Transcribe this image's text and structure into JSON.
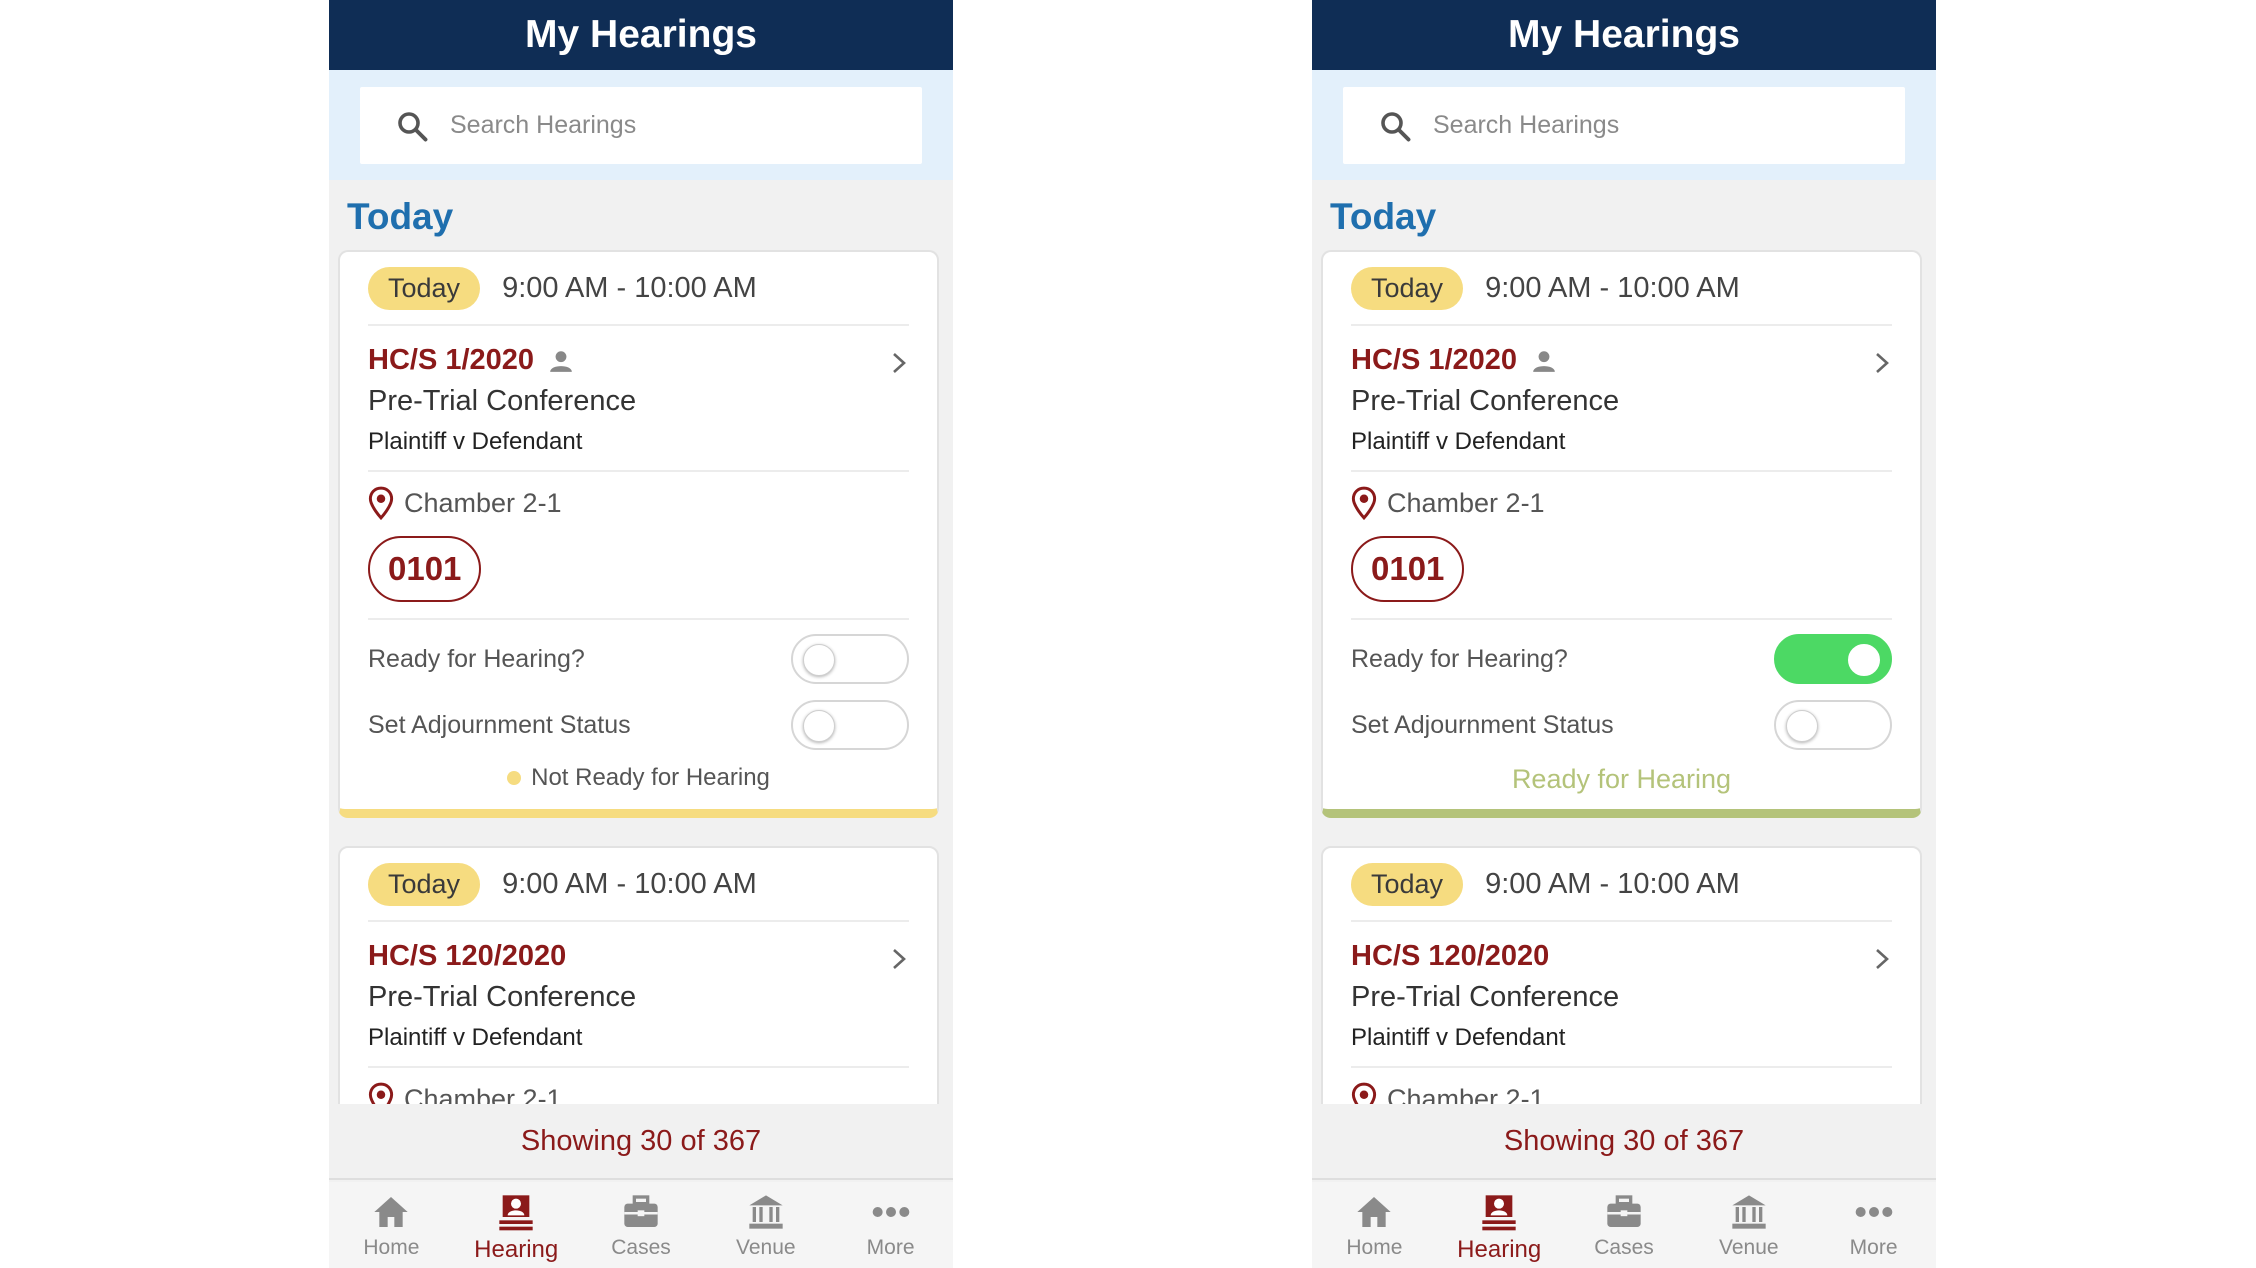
{
  "screens": [
    {
      "header_title": "My Hearings",
      "search_placeholder": "Search Hearings",
      "section_title": "Today",
      "cards": [
        {
          "badge": "Today",
          "time": "9:00 AM - 10:00 AM",
          "case_no": "HC/S 1/2020",
          "case_type": "Pre-Trial Conference",
          "parties": "Plaintiff v Defendant",
          "location": "Chamber 2-1",
          "room": "0101",
          "ready_label": "Ready for Hearing?",
          "ready_on": false,
          "adjourn_label": "Set Adjournment Status",
          "adjourn_on": false,
          "status": "Not Ready for Hearing"
        },
        {
          "badge": "Today",
          "time": "9:00 AM - 10:00 AM",
          "case_no": "HC/S 120/2020",
          "case_type": "Pre-Trial Conference",
          "parties": "Plaintiff v Defendant",
          "location": "Chamber 2-1"
        }
      ],
      "showing": "Showing 30 of 367"
    },
    {
      "header_title": "My Hearings",
      "search_placeholder": "Search Hearings",
      "section_title": "Today",
      "cards": [
        {
          "badge": "Today",
          "time": "9:00 AM - 10:00 AM",
          "case_no": "HC/S 1/2020",
          "case_type": "Pre-Trial Conference",
          "parties": "Plaintiff v Defendant",
          "location": "Chamber 2-1",
          "room": "0101",
          "ready_label": "Ready for Hearing?",
          "ready_on": true,
          "adjourn_label": "Set Adjournment Status",
          "adjourn_on": false,
          "status": "Ready for Hearing"
        },
        {
          "badge": "Today",
          "time": "9:00 AM - 10:00 AM",
          "case_no": "HC/S 120/2020",
          "case_type": "Pre-Trial Conference",
          "parties": "Plaintiff v Defendant",
          "location": "Chamber 2-1"
        }
      ],
      "showing": "Showing 30 of 367"
    }
  ],
  "tabbar": {
    "home": "Home",
    "hearing": "Hearing",
    "cases": "Cases",
    "venue": "Venue",
    "more": "More",
    "active": "hearing"
  },
  "icons": [
    "search-icon",
    "person-icon",
    "chevron-right-icon",
    "location-pin-icon",
    "home-icon",
    "hearing-icon",
    "briefcase-icon",
    "courthouse-icon",
    "more-dots-icon"
  ],
  "colors": {
    "header_bg": "#0f2d55",
    "accent_red": "#8b1a1a",
    "section_blue": "#1f6fae",
    "badge_yellow": "#f6dc80",
    "toggle_on_green": "#4cd964",
    "ready_green": "#b4c37a"
  }
}
